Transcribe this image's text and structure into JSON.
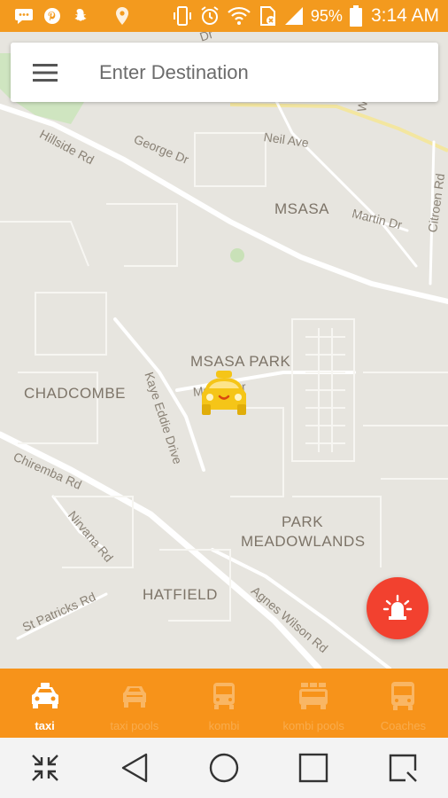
{
  "status_bar": {
    "battery_percent": "95%",
    "time": "3:14 AM",
    "icons": [
      "messaging-icon",
      "pinterest-icon",
      "snapchat-icon",
      "location-icon",
      "vibrate-icon",
      "alarm-icon",
      "wifi-icon",
      "no-sim-icon",
      "signal-icon",
      "battery-icon"
    ]
  },
  "search": {
    "placeholder": "Enter Destination",
    "menu_icon": "hamburger-menu-icon"
  },
  "map": {
    "areas": [
      "MSASA",
      "MSASA PARK",
      "CHADCOMBE",
      "PARK",
      "MEADOWLANDS",
      "HATFIELD"
    ],
    "streets": [
      "Hillside Rd",
      "George Dr",
      "Neil Ave",
      "Martin Dr",
      "Citroen Rd",
      "Kaye Eddie Drive",
      "Msasa Dr",
      "Chiremba Rd",
      "Nirvana Rd",
      "St Patricks Rd",
      "Agnes Wilson Rd",
      "Wils",
      "Dr"
    ],
    "marker_icon": "taxi-marker-icon"
  },
  "panic_button": {
    "icon": "siren-icon"
  },
  "tabs": [
    {
      "label": "taxi",
      "icon": "taxi-icon",
      "active": true
    },
    {
      "label": "taxi pools",
      "icon": "taxi-pools-icon",
      "active": false
    },
    {
      "label": "kombi",
      "icon": "kombi-icon",
      "active": false
    },
    {
      "label": "kombi pools",
      "icon": "kombi-pools-icon",
      "active": false
    },
    {
      "label": "Coaches",
      "icon": "coach-icon",
      "active": false
    }
  ],
  "nav_bar": [
    "collapse-icon",
    "back-icon",
    "home-icon",
    "recents-icon",
    "screen-capture-icon"
  ],
  "colors": {
    "status_bar": "#f39a1e",
    "tab_bar": "#f7931a",
    "panic_button": "#f2412f",
    "map_background": "#e7e5df",
    "marker": "#f5c518"
  }
}
